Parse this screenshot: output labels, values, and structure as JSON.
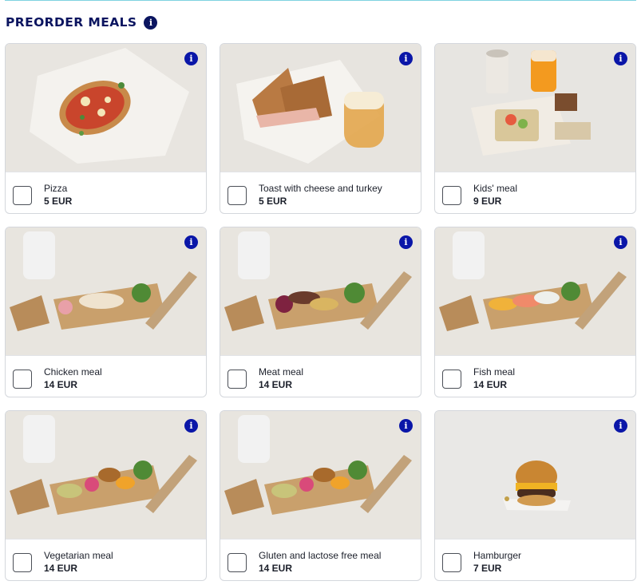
{
  "header": {
    "title": "PREORDER MEALS",
    "info_icon": "info-icon"
  },
  "meals": [
    {
      "name": "Pizza",
      "price": "5 EUR",
      "checked": false
    },
    {
      "name": "Toast with cheese and turkey",
      "price": "5 EUR",
      "checked": false
    },
    {
      "name": "Kids' meal",
      "price": "9 EUR",
      "checked": false
    },
    {
      "name": "Chicken meal",
      "price": "14 EUR",
      "checked": false
    },
    {
      "name": "Meat meal",
      "price": "14 EUR",
      "checked": false
    },
    {
      "name": "Fish meal",
      "price": "14 EUR",
      "checked": false
    },
    {
      "name": "Vegetarian meal",
      "price": "14 EUR",
      "checked": false
    },
    {
      "name": "Gluten and lactose free meal",
      "price": "14 EUR",
      "checked": false
    },
    {
      "name": "Hamburger",
      "price": "7 EUR",
      "checked": false
    }
  ],
  "colors": {
    "heading": "#0b1560",
    "info_button": "#0a16a8",
    "card_border": "#d4d7dc",
    "top_rule": "#7fd3e0"
  }
}
